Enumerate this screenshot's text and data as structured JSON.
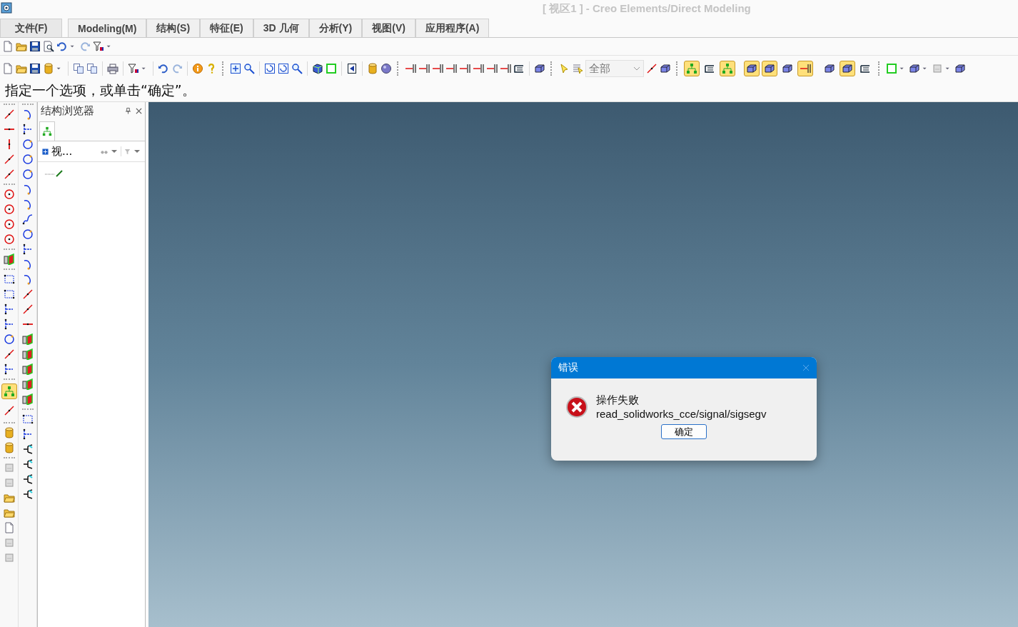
{
  "window": {
    "title": "[ 视区1 ] - Creo Elements/Direct Modeling",
    "active": false
  },
  "menu": [
    {
      "label": "文件(F)",
      "kind": "file"
    },
    {
      "label": "Modeling(M)",
      "kind": "tab"
    },
    {
      "label": "结构(S)",
      "kind": "tab"
    },
    {
      "label": "特征(E)",
      "kind": "tab"
    },
    {
      "label": "3D 几何",
      "kind": "tab"
    },
    {
      "label": "分析(Y)",
      "kind": "tab"
    },
    {
      "label": "视图(V)",
      "kind": "tab"
    },
    {
      "label": "应用程序(A)",
      "kind": "tab"
    }
  ],
  "main_toolbar": {
    "filter_value": "全部",
    "view_buttons": [
      {
        "selected": true
      },
      {
        "selected": false
      },
      {
        "selected": true
      },
      {
        "selected": true
      },
      {
        "selected": true
      },
      {
        "selected": false
      },
      {
        "selected": true
      },
      {
        "selected": false
      },
      {
        "selected": true
      },
      {
        "selected": false
      }
    ]
  },
  "prompt": "指定一个选项，或单击“确定”。",
  "left_palette": {
    "buttons": [
      {
        "selected": true
      },
      {
        "selected": false
      }
    ]
  },
  "structure_browser": {
    "title": "结构浏览器",
    "tabs": [
      {
        "selected": true
      }
    ],
    "view_label": "视..."
  },
  "dialog": {
    "title": "错误",
    "lines": [
      "操作失败",
      "read_solidworks_cce/signal/sigsegv"
    ],
    "button": "确定"
  }
}
